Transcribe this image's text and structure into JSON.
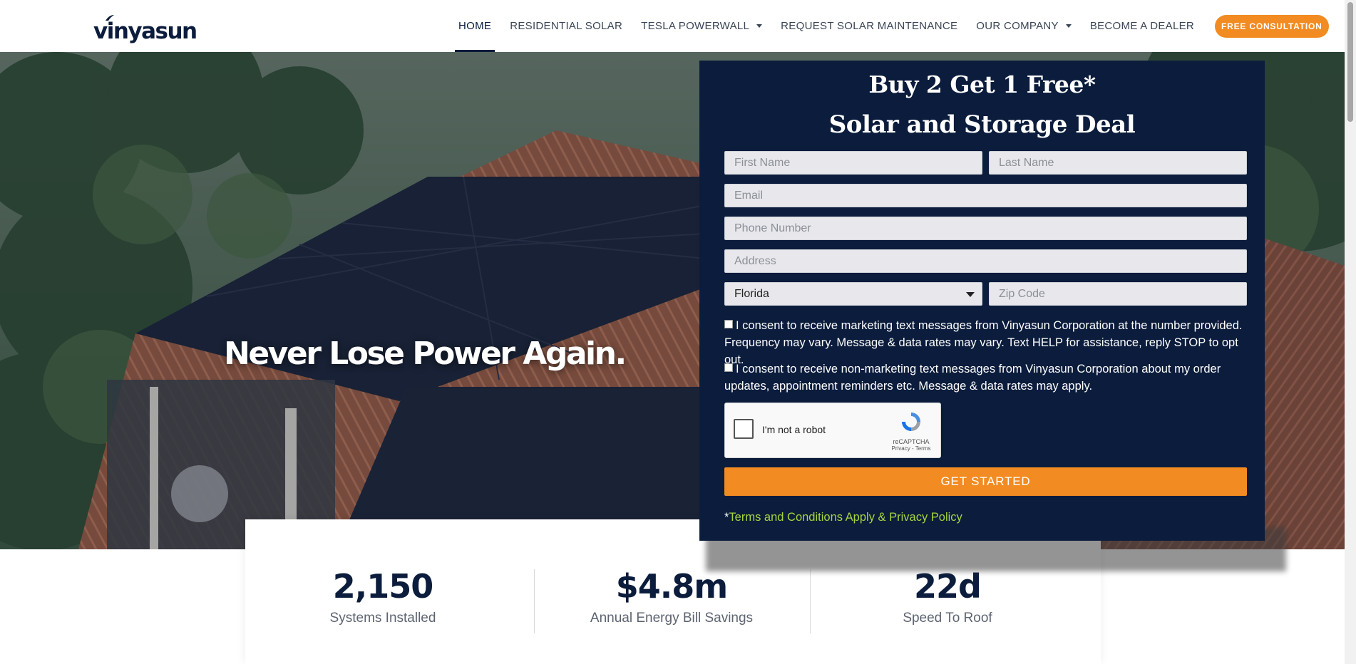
{
  "brand": {
    "logo_text": "vinyasun"
  },
  "nav": {
    "items": [
      {
        "label": "HOME",
        "active": true,
        "dropdown": false
      },
      {
        "label": "RESIDENTIAL SOLAR",
        "active": false,
        "dropdown": false
      },
      {
        "label": "TESLA POWERWALL",
        "active": false,
        "dropdown": true
      },
      {
        "label": "REQUEST SOLAR MAINTENANCE",
        "active": false,
        "dropdown": false
      },
      {
        "label": "OUR COMPANY",
        "active": false,
        "dropdown": true
      },
      {
        "label": "BECOME A DEALER",
        "active": false,
        "dropdown": false
      }
    ],
    "cta_label": "FREE CONSULTATION"
  },
  "hero": {
    "heading": "Never Lose Power Again."
  },
  "form": {
    "title_line1": "Buy 2 Get 1 Free*",
    "title_line2": "Solar and Storage Deal",
    "first_name_placeholder": "First Name",
    "last_name_placeholder": "Last Name",
    "email_placeholder": "Email",
    "phone_placeholder": "Phone Number",
    "address_placeholder": "Address",
    "state_value": "Florida",
    "zip_placeholder": "Zip Code",
    "consent_marketing": "I consent to receive marketing text messages from Vinyasun Corporation at the number provided. Frequency may vary. Message & data rates may vary. Text HELP for assistance, reply STOP to opt out.",
    "consent_nonmarketing": "I consent to receive non-marketing text messages from Vinyasun Corporation about my order updates, appointment reminders etc. Message & data rates may apply.",
    "recaptcha": {
      "label": "I'm not a robot",
      "brand": "reCAPTCHA",
      "links": "Privacy - Terms"
    },
    "submit_label": "GET STARTED",
    "terms_prefix": "*",
    "terms_link": "Terms and Conditions Apply & Privacy Policy"
  },
  "stats": [
    {
      "value": "2,150",
      "label": "Systems Installed"
    },
    {
      "value": "$4.8m",
      "label": "Annual Energy Bill Savings"
    },
    {
      "value": "22d",
      "label": "Speed To Roof"
    }
  ],
  "colors": {
    "navy": "#0b1c3c",
    "orange": "#f28b21",
    "green_link": "#a6d63c"
  },
  "icons": [
    "chevron-down-icon",
    "recaptcha-icon",
    "logo-leaf-icon"
  ]
}
